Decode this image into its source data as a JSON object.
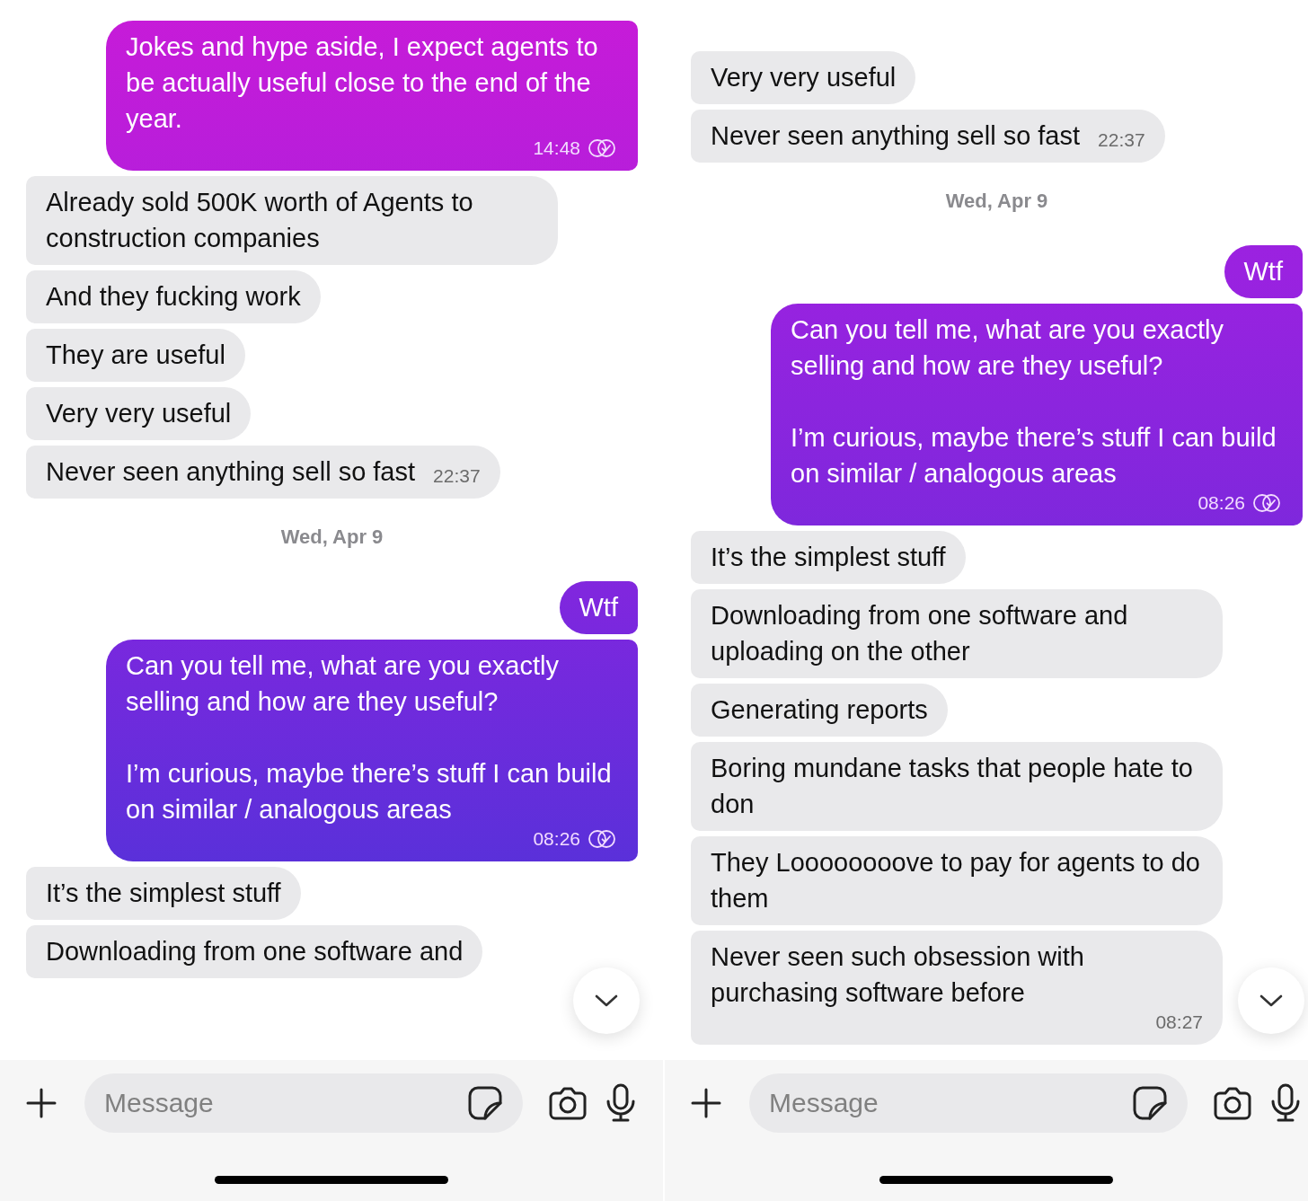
{
  "panels": [
    {
      "messages": [
        {
          "kind": "outgoing",
          "text": "Jokes and hype aside, I expect agents to be actually useful close to the end of the year.",
          "time": "14:48",
          "read": true
        },
        {
          "kind": "incoming",
          "text": "Already sold 500K worth of Agents to construction companies"
        },
        {
          "kind": "incoming",
          "text": "And they fucking work"
        },
        {
          "kind": "incoming",
          "text": "They are useful"
        },
        {
          "kind": "incoming",
          "text": "Very very useful"
        },
        {
          "kind": "incoming",
          "text": "Never seen anything sell so fast",
          "time": "22:37"
        },
        {
          "kind": "date",
          "text": "Wed, Apr 9"
        },
        {
          "kind": "outgoing",
          "text": "Wtf"
        },
        {
          "kind": "outgoing",
          "text": "Can you tell me, what are you exactly selling and how are they useful?\n\nI’m curious, maybe there’s stuff I can build on similar / analogous areas",
          "time": "08:26",
          "read": true
        },
        {
          "kind": "incoming",
          "text": "It’s the simplest stuff"
        },
        {
          "kind": "incoming",
          "text": "Downloading from one software and"
        }
      ],
      "composer": {
        "placeholder": "Message"
      }
    },
    {
      "messages": [
        {
          "kind": "incoming",
          "text": "Very very useful"
        },
        {
          "kind": "incoming",
          "text": "Never seen anything sell so fast",
          "time": "22:37"
        },
        {
          "kind": "date",
          "text": "Wed, Apr 9"
        },
        {
          "kind": "outgoing",
          "text": "Wtf"
        },
        {
          "kind": "outgoing",
          "text": "Can you tell me, what are you exactly selling and how are they useful?\n\nI’m curious, maybe there’s stuff I can build on similar / analogous areas",
          "time": "08:26",
          "read": true
        },
        {
          "kind": "incoming",
          "text": "It’s the simplest stuff"
        },
        {
          "kind": "incoming",
          "text": "Downloading from one software and uploading on the other"
        },
        {
          "kind": "incoming",
          "text": "Generating reports"
        },
        {
          "kind": "incoming",
          "text": "Boring mundane tasks that people hate to don"
        },
        {
          "kind": "incoming",
          "text": "They Loooooooove to pay for agents to do them"
        },
        {
          "kind": "incoming",
          "text": "Never seen such obsession with purchasing software before",
          "time": "08:27"
        }
      ],
      "composer": {
        "placeholder": "Message"
      }
    }
  ]
}
